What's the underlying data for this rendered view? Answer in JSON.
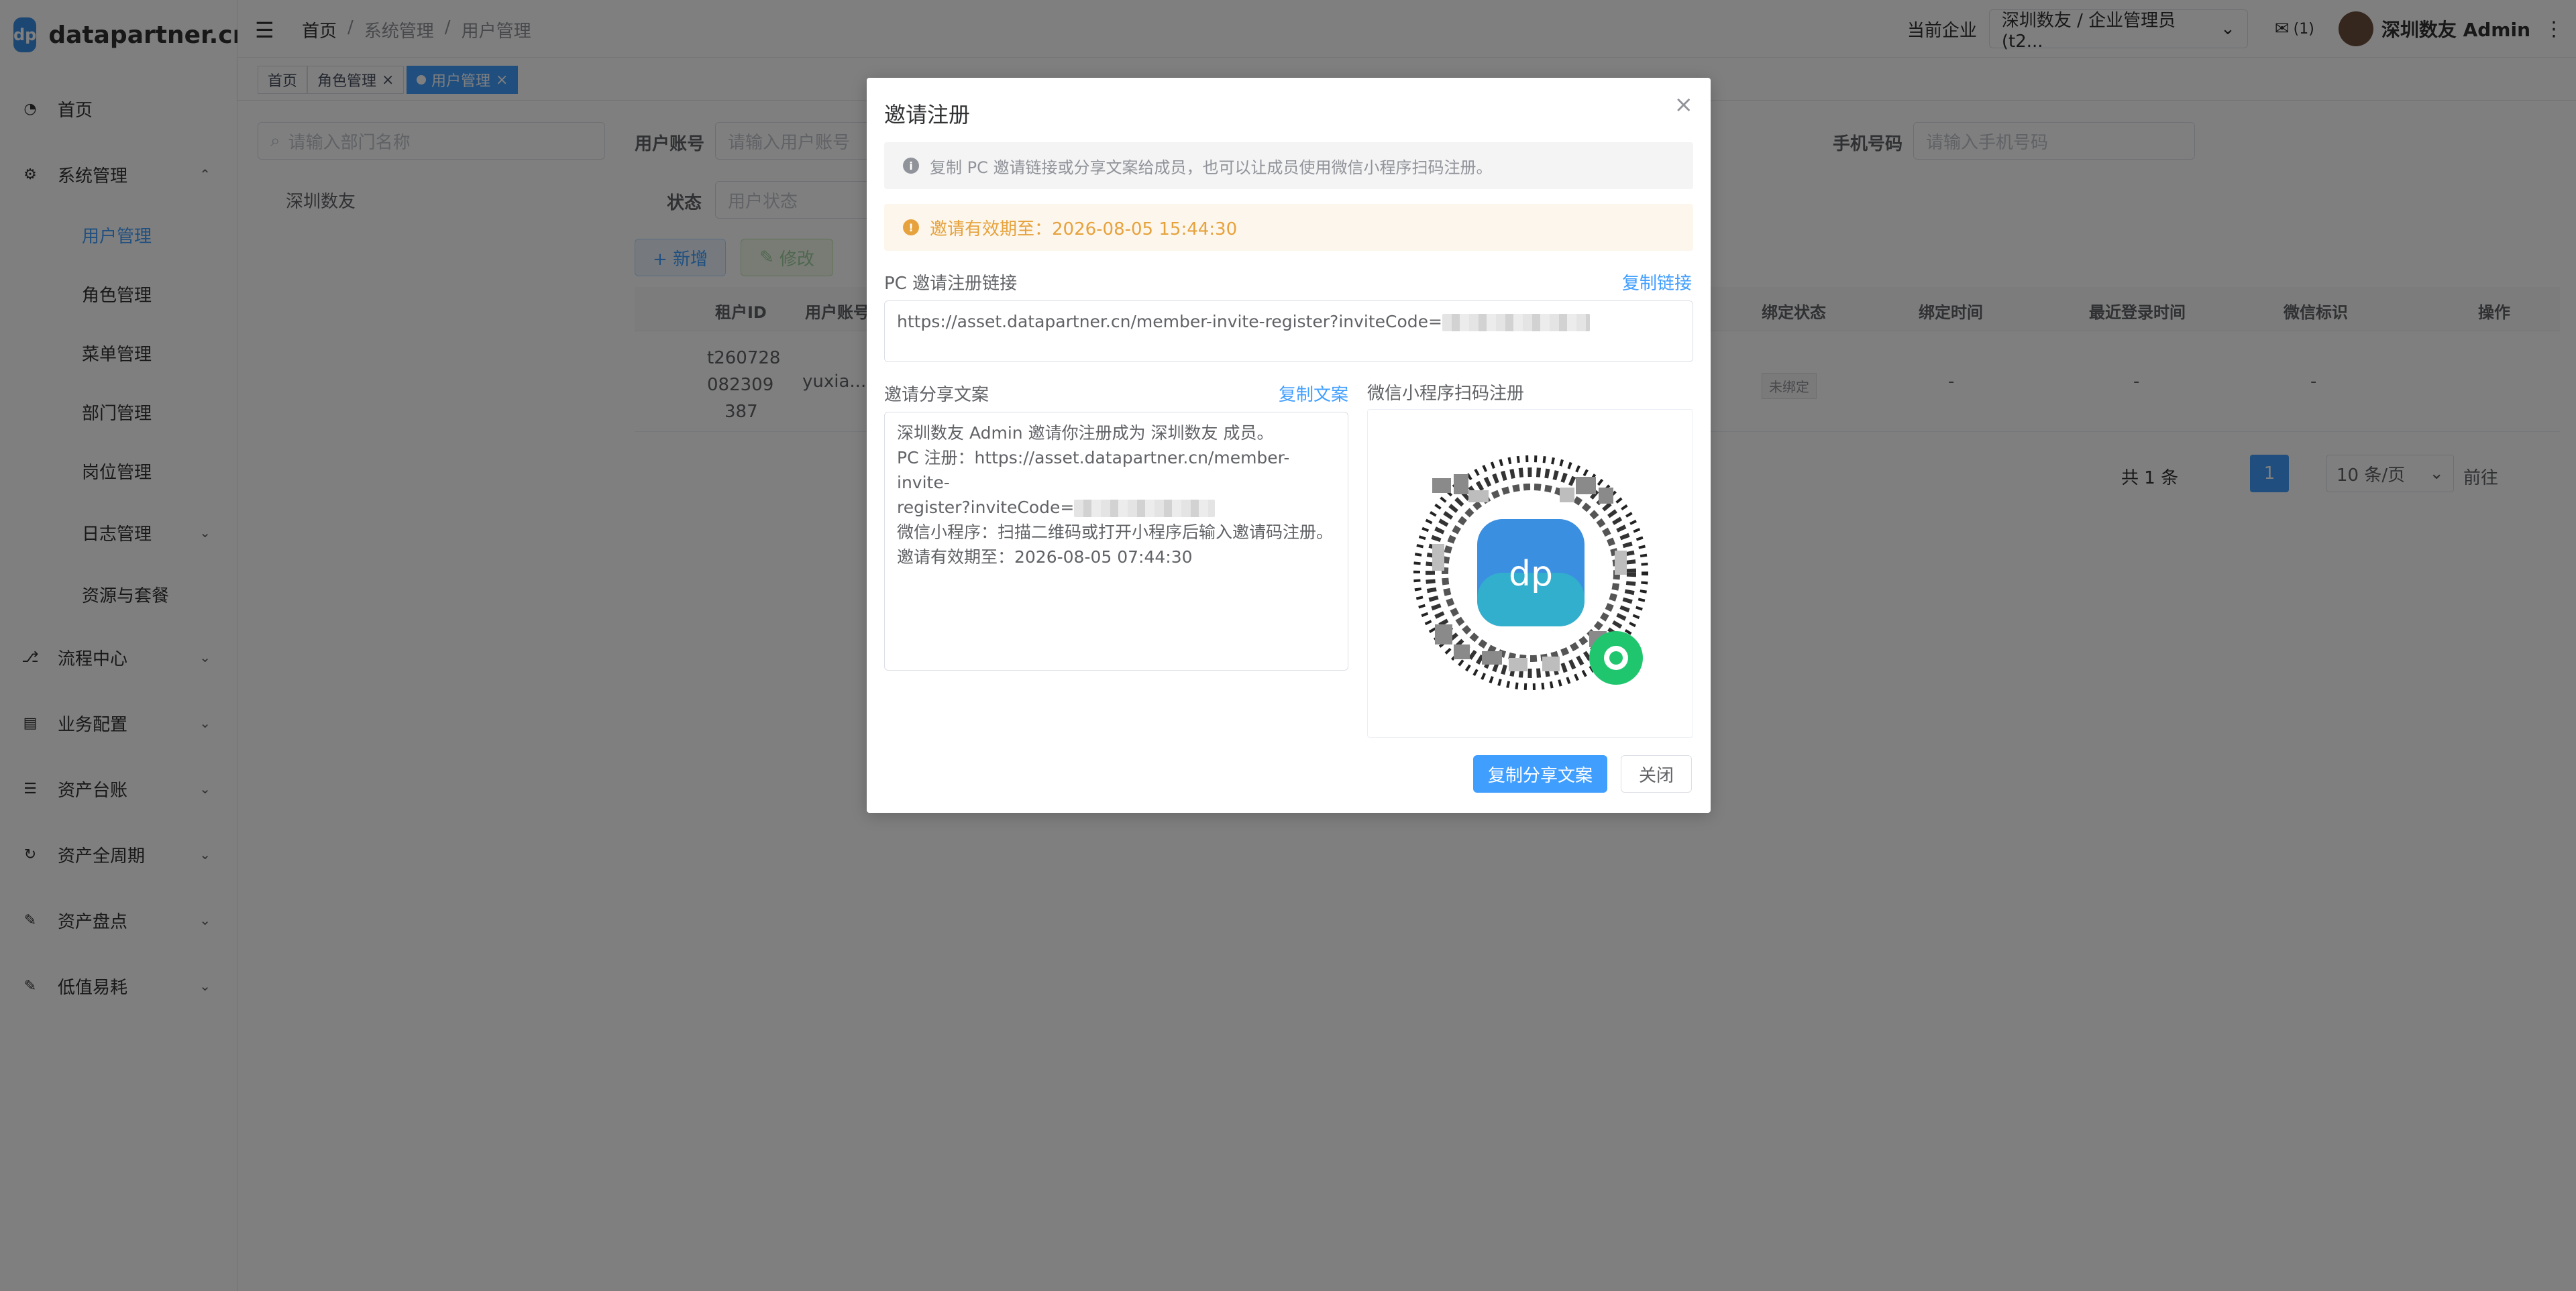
{
  "app": {
    "logo_badge": "dp",
    "logo_text": "datapartner.cn"
  },
  "sidebar": {
    "home": "首页",
    "system": "系统管理",
    "sub": [
      "用户管理",
      "角色管理",
      "菜单管理",
      "部门管理",
      "岗位管理",
      "日志管理",
      "资源与套餐"
    ],
    "groups": [
      "流程中心",
      "业务配置",
      "资产台账",
      "资产全周期",
      "资产盘点",
      "低值易耗"
    ]
  },
  "header": {
    "breadcrumb": [
      "首页",
      "系统管理",
      "用户管理"
    ],
    "company_label": "当前企业",
    "company_value": "深圳数友 / 企业管理员 (t2...",
    "mail_count": "(1)",
    "username": "深圳数友 Admin"
  },
  "tags": [
    "首页",
    "角色管理",
    "用户管理"
  ],
  "page": {
    "dept_search_placeholder": "请输入部门名称",
    "dept_tree_root": "深圳数友",
    "user_account_label": "用户账号",
    "user_account_placeholder": "请输入用户账号",
    "status_label": "状态",
    "status_placeholder": "用户状态",
    "phone_label": "手机号码",
    "phone_placeholder": "请输入手机号码",
    "btn_add": "+ 新增",
    "btn_edit": "修改",
    "columns": [
      "租户ID",
      "用户账号",
      "绑定状态",
      "绑定时间",
      "最近登录时间",
      "微信标识",
      "操作"
    ],
    "row": {
      "tenant_id_1": "t260728",
      "tenant_id_2": "082309",
      "tenant_id_3": "387",
      "account": "yuxia...",
      "bind_status": "未绑定",
      "bind_time": "-",
      "last_login": "-",
      "wechat": "-"
    },
    "pager": {
      "total": "共 1 条",
      "current": "1",
      "size": "10 条/页",
      "goto": "前往"
    }
  },
  "modal": {
    "title": "邀请注册",
    "info": "复制 PC 邀请链接或分享文案给成员，也可以让成员使用微信小程序扫码注册。",
    "expiry_notice": "邀请有效期至：2026-08-05 15:44:30",
    "pc_link_label": "PC 邀请注册链接",
    "copy_link": "复制链接",
    "pc_link_prefix": "https://asset.datapartner.cn/member-invite-register?inviteCode=",
    "share_label": "邀请分享文案",
    "copy_text": "复制文案",
    "share_line1": "深圳数友 Admin 邀请你注册成为 深圳数友 成员。",
    "share_line2": "PC 注册：https://asset.datapartner.cn/member-invite-",
    "share_line3": "register?inviteCode=",
    "share_line4": "微信小程序：扫描二维码或打开小程序后输入邀请码注册。",
    "share_line5": "邀请有效期至：2026-08-05 07:44:30",
    "miniprogram_label": "微信小程序扫码注册",
    "qr_center": "dp",
    "btn_copy_share": "复制分享文案",
    "btn_close": "关闭"
  }
}
